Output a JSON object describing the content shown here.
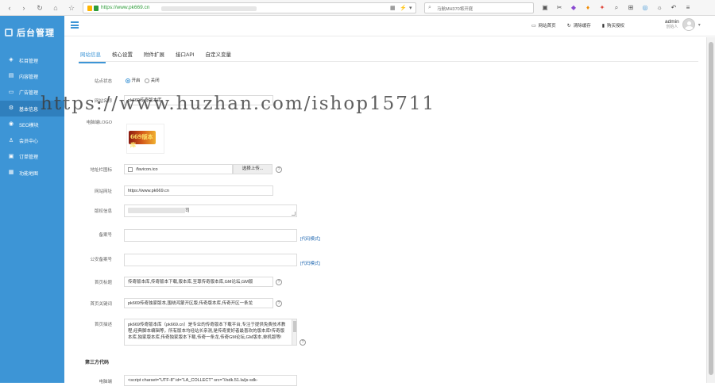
{
  "browser": {
    "url": "https://www.pk669.cn",
    "search_text": "马航MH370将开庭",
    "icons": [
      "tab-grid-icon",
      "scissors-icon",
      "badge-icon",
      "plugin-icon",
      "translate-icon",
      "search-icon",
      "grid-icon",
      "image-icon",
      "settings-icon",
      "undo-icon",
      "menu-icon"
    ]
  },
  "sidebar": {
    "logo_text": "后台管理",
    "items": [
      {
        "label": "栏目管理",
        "icon": "layers-icon"
      },
      {
        "label": "内容管理",
        "icon": "document-icon"
      },
      {
        "label": "广告管理",
        "icon": "folder-icon"
      },
      {
        "label": "基本信息",
        "icon": "gear-icon"
      },
      {
        "label": "SEO模块",
        "icon": "globe-icon"
      },
      {
        "label": "会员中心",
        "icon": "user-icon"
      },
      {
        "label": "订单管理",
        "icon": "order-icon"
      },
      {
        "label": "功能地图",
        "icon": "map-icon"
      }
    ]
  },
  "header": {
    "links": [
      {
        "label": "网站首页",
        "icon": "monitor-icon"
      },
      {
        "label": "清除缓存",
        "icon": "refresh-icon"
      },
      {
        "label": "购买授权",
        "icon": "bookmark-icon"
      }
    ],
    "user_name": "admin",
    "user_role": "创始人"
  },
  "main": {
    "tabs": [
      "网站信息",
      "核心设置",
      "附件扩展",
      "接口API",
      "自定义变量"
    ],
    "site_status": {
      "label": "站点状态",
      "on": "开启",
      "off": "关闭"
    },
    "site_name": {
      "label": "网站名称",
      "value": "pk669传奇版本库"
    },
    "pc_logo": {
      "label": "电脑端LOGO",
      "logo_text": "669版本库"
    },
    "favicon": {
      "label": "地址栏图标",
      "value": "/favicon.ico",
      "button": "选择上传..."
    },
    "site_url": {
      "label": "网站网址",
      "value": "https://www.pk669.cn"
    },
    "copyright": {
      "label": "版权信息",
      "value": "司"
    },
    "icp": {
      "label": "备案号",
      "value": "",
      "link": "[代码模式]"
    },
    "police_icp": {
      "label": "公安备案号",
      "value": "",
      "link": "[代码模式]"
    },
    "home_title": {
      "label": "首页标题",
      "value": "传奇版本库,传奇版本下载,版本库,至尊传奇版本库,GM论坛,GM版"
    },
    "home_keywords": {
      "label": "首页关键词",
      "value": "pk669传奇独家版本,围绕鸿蒙开区版,传奇版本库,传奇开区一条龙"
    },
    "home_desc": {
      "label": "首页描述",
      "value": "pk669传奇版本库（pk669.cn）是专业的传奇版本下载平台,专注于提供免费技术教程,经典脚本编辑等，所有版本均经站长亲测,是传奇爱好者最喜欢的版本库!传奇版本库,独家版本库,传奇独家版本下载,传奇一条龙,传奇GM论坛,GM版本,单机版等!"
    },
    "section_third": "第三方代码",
    "pc_code": {
      "label": "电脑端",
      "value": "<script charset=\"UTF-8\" id=\"LA_COLLECT\" src=\"//sdk.51.la/js-sdk-"
    }
  },
  "watermark": "https://www.huzhan.com/ishop15711"
}
